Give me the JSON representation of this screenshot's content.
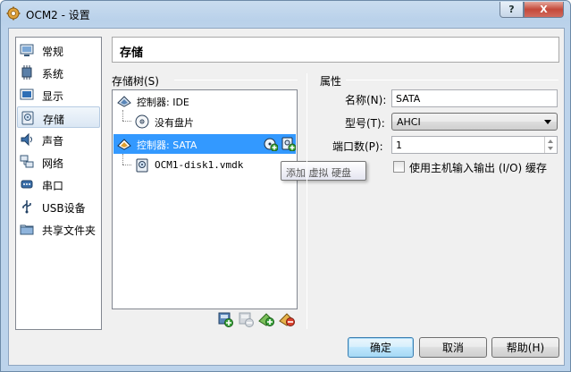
{
  "window": {
    "title": "OCM2 - 设置",
    "help_button": "?",
    "close_button": "X"
  },
  "sidebar": {
    "items": [
      {
        "label": "常规",
        "icon": "monitor-general-icon"
      },
      {
        "label": "系统",
        "icon": "chip-system-icon"
      },
      {
        "label": "显示",
        "icon": "display-icon"
      },
      {
        "label": "存储",
        "icon": "storage-disk-icon",
        "selected": true
      },
      {
        "label": "声音",
        "icon": "speaker-audio-icon"
      },
      {
        "label": "网络",
        "icon": "network-icon"
      },
      {
        "label": "串口",
        "icon": "serial-port-icon"
      },
      {
        "label": "USB设备",
        "icon": "usb-icon"
      },
      {
        "label": "共享文件夹",
        "icon": "shared-folder-icon"
      }
    ]
  },
  "page": {
    "title": "存储"
  },
  "storage_tree": {
    "label": "存储树(S)",
    "rows": [
      {
        "label": "控制器: IDE",
        "icon": "ide-controller-icon",
        "type": "controller"
      },
      {
        "label": "没有盘片",
        "icon": "optical-disc-icon",
        "type": "attachment"
      },
      {
        "label": "控制器: SATA",
        "icon": "sata-controller-icon",
        "type": "controller",
        "selected": true
      },
      {
        "label": "OCM1-disk1.vmdk",
        "icon": "hard-disk-icon",
        "type": "attachment"
      }
    ],
    "tooltip": "添加 虚拟 硬盘",
    "toolbar": [
      "add-controller-icon",
      "remove-controller-icon",
      "add-attachment-icon",
      "remove-attachment-icon"
    ]
  },
  "attributes": {
    "label": "属性",
    "name_label": "名称(N):",
    "name_value": "SATA",
    "type_label": "型号(T):",
    "type_value": "AHCI",
    "ports_label": "端口数(P):",
    "ports_value": "1",
    "host_io_label": "使用主机输入输出 (I/O) 缓存",
    "host_io_checked": false
  },
  "buttons": {
    "ok": "确定",
    "cancel": "取消",
    "help": "帮助(H)"
  },
  "colors": {
    "selection": "#3399ff",
    "frame": "#b9d1ea"
  }
}
